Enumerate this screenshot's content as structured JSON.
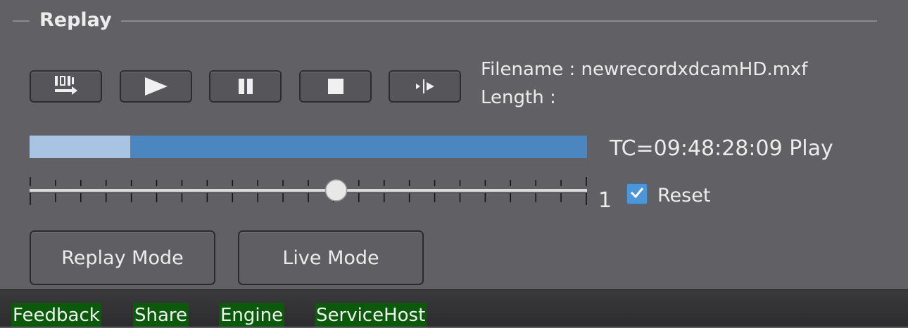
{
  "replay": {
    "group_title": "Replay",
    "transport": [
      {
        "icon": "load-clip-icon"
      },
      {
        "icon": "play-icon"
      },
      {
        "icon": "pause-icon"
      },
      {
        "icon": "stop-icon"
      },
      {
        "icon": "step-frame-icon"
      }
    ],
    "filename_text": "Filename : newrecordxdcamHD.mxf",
    "length_text": "Length :",
    "progress_fraction": 0.18,
    "timecode_status": "TC=09:48:28:09 Play",
    "speed_slider_fraction": 0.55,
    "speed_value": "1",
    "reset_label": "Reset",
    "reset_checked": true,
    "replay_mode_label": "Replay Mode",
    "live_mode_label": "Live Mode"
  },
  "statusbar": {
    "items": [
      "Feedback",
      "Share",
      "Engine",
      "ServiceHost"
    ],
    "item_color": "#0b5a0b"
  },
  "colors": {
    "progress_track": "#4c86c0",
    "progress_fill": "#a9c3e3",
    "checkbox": "#4c96d8"
  }
}
